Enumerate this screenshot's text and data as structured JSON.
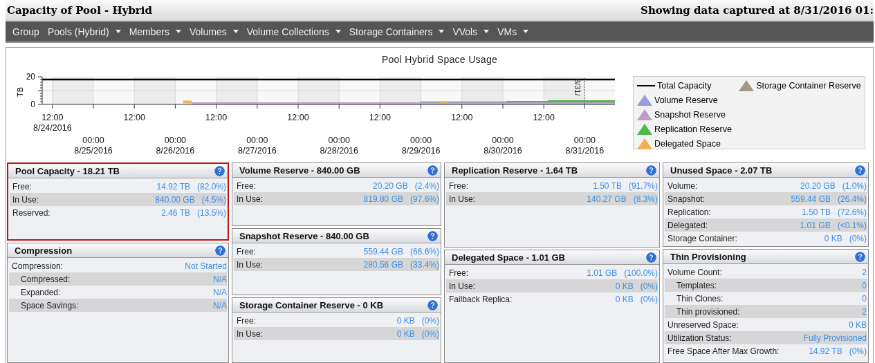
{
  "header": {
    "title": "Capacity of Pool - Hybrid",
    "captured": "Showing data captured at 8/31/2016 01:"
  },
  "nav": [
    {
      "label": "Group",
      "menu": false
    },
    {
      "label": "Pools (Hybrid)",
      "menu": true
    },
    {
      "label": "Members",
      "menu": true
    },
    {
      "label": "Volumes",
      "menu": true
    },
    {
      "label": "Volume Collections",
      "menu": true
    },
    {
      "label": "Storage Containers",
      "menu": true
    },
    {
      "label": "VVols",
      "menu": true
    },
    {
      "label": "VMs",
      "menu": true
    }
  ],
  "chart": {
    "title": "Pool Hybrid Space Usage",
    "y_axis_label": "TB",
    "y_ticks": [
      "20",
      "0"
    ],
    "x_ticks": [
      {
        "time": "12:00",
        "date": "8/24/2016"
      },
      {
        "time": "00:00",
        "date": "8/25/2016"
      },
      {
        "time": "12:00"
      },
      {
        "time": "00:00",
        "date": "8/26/2016"
      },
      {
        "time": "12:00"
      },
      {
        "time": "00:00",
        "date": "8/27/2016"
      },
      {
        "time": "12:00"
      },
      {
        "time": "00:00",
        "date": "8/28/2016"
      },
      {
        "time": "12:00"
      },
      {
        "time": "00:00",
        "date": "8/29/2016"
      },
      {
        "time": "12:00"
      },
      {
        "time": "00:00",
        "date": "8/30/2016"
      },
      {
        "time": "12:00"
      },
      {
        "time": "00:00",
        "date": "8/31/2016"
      }
    ],
    "marker": "8/31/",
    "legend": [
      {
        "label": "Total Capacity",
        "kind": "line",
        "color": "#000000"
      },
      {
        "label": "Volume Reserve",
        "kind": "area",
        "color": "#9a9ae0"
      },
      {
        "label": "Snapshot Reserve",
        "kind": "area",
        "color": "#c09ac8"
      },
      {
        "label": "Replication Reserve",
        "kind": "area",
        "color": "#4cbb4c"
      },
      {
        "label": "Delegated Space",
        "kind": "area",
        "color": "#f0b050"
      },
      {
        "label": "Storage Container Reserve",
        "kind": "area",
        "color": "#a09888"
      }
    ]
  },
  "columns": [
    {
      "cards": [
        {
          "title": "Pool Capacity - 18.21 TB",
          "selected": true,
          "rows": [
            {
              "label": "Free:",
              "value": "14.92 TB",
              "percent": "(82.0%)"
            },
            {
              "label": "In Use:",
              "value": "840.00 GB",
              "percent": "(4.5%)"
            },
            {
              "label": "Reserved:",
              "value": "2.46 TB",
              "percent": "(13.5%)"
            }
          ]
        },
        {
          "title": "Compression",
          "selected": false,
          "rows": [
            {
              "label": "Compression:",
              "value": "Not Started",
              "children": [
                {
                  "label": "Compressed:",
                  "value": "N/A"
                },
                {
                  "label": "Expanded:",
                  "value": "N/A"
                },
                {
                  "label": "Space Savings:",
                  "value": "N/A"
                }
              ]
            }
          ]
        }
      ]
    },
    {
      "cards": [
        {
          "title": "Volume Reserve - 840.00 GB",
          "selected": false,
          "rows": [
            {
              "label": "Free:",
              "value": "20.20 GB",
              "percent": "(2.4%)"
            },
            {
              "label": "In Use:",
              "value": "819.80 GB",
              "percent": "(97.6%)"
            }
          ]
        },
        {
          "title": "Snapshot Reserve - 840.00 GB",
          "selected": false,
          "rows": [
            {
              "label": "Free:",
              "value": "559.44 GB",
              "percent": "(66.6%)"
            },
            {
              "label": "In Use:",
              "value": "280.56 GB",
              "percent": "(33.4%)"
            }
          ]
        },
        {
          "title": "Storage Container Reserve - 0 KB",
          "selected": false,
          "rows": [
            {
              "label": "Free:",
              "value": "0 KB",
              "percent": "(0%)"
            },
            {
              "label": "In Use:",
              "value": "0 KB",
              "percent": "(0%)"
            }
          ]
        }
      ]
    },
    {
      "cards": [
        {
          "title": "Replication Reserve - 1.64 TB",
          "selected": false,
          "rows": [
            {
              "label": "Free:",
              "value": "1.50 TB",
              "percent": "(91.7%)"
            },
            {
              "label": "In Use:",
              "value": "140.27 GB",
              "percent": "(8.3%)"
            }
          ]
        },
        {
          "title": "Delegated Space - 1.01 GB",
          "selected": false,
          "rows": [
            {
              "label": "Free:",
              "value": "1.01 GB",
              "percent": "(100.0%)"
            },
            {
              "label": "In Use:",
              "value": "0 KB",
              "percent": "(0%)"
            },
            {
              "label": "Failback Replica:",
              "value": "0 KB",
              "percent": "(0%)"
            }
          ]
        }
      ]
    },
    {
      "cards": [
        {
          "title": "Unused Space - 2.07 TB",
          "selected": false,
          "rows": [
            {
              "label": "Volume:",
              "value": "20.20 GB",
              "percent": "(1.0%)"
            },
            {
              "label": "Snapshot:",
              "value": "559.44 GB",
              "percent": "(26.4%)"
            },
            {
              "label": "Replication:",
              "value": "1.50 TB",
              "percent": "(72.6%)"
            },
            {
              "label": "Delegated:",
              "value": "1.01 GB",
              "percent": "(<0.1%)"
            },
            {
              "label": "Storage Container:",
              "value": "0 KB",
              "percent": "(0%)"
            }
          ]
        },
        {
          "title": "Thin Provisioning",
          "selected": false,
          "rows": [
            {
              "label": "Volume Count:",
              "value": "2",
              "children": [
                {
                  "label": "Templates:",
                  "value": "0"
                },
                {
                  "label": "Thin Clones:",
                  "value": "0"
                },
                {
                  "label": "Thin provisioned:",
                  "value": "2"
                }
              ]
            },
            {
              "label": "Unreserved Space:",
              "value": "0 KB"
            },
            {
              "label": "Utilization Status:",
              "value": "Fully Provisioned"
            },
            {
              "label": "Free Space After Max Growth:",
              "value": "14.92 TB",
              "percent": "(0%)"
            }
          ]
        }
      ]
    }
  ]
}
